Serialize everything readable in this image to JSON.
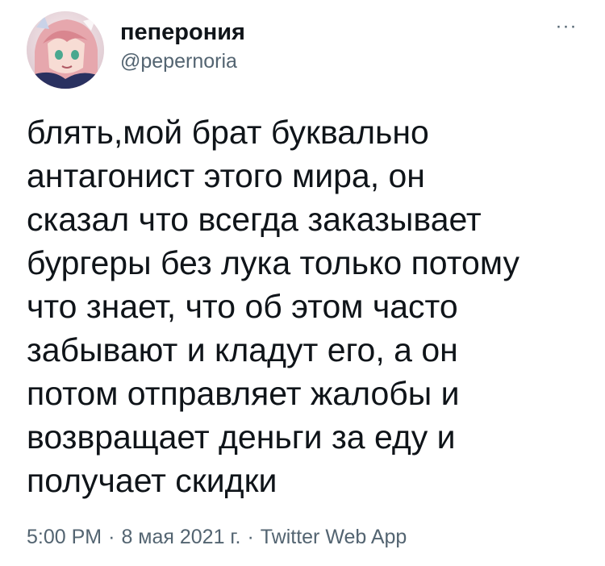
{
  "tweet": {
    "display_name": "пеперония",
    "handle": "@pepernoria",
    "more_icon": "more-dots-icon",
    "text_lines": [
      "блять,мой брат буквально",
      "антагонист этого мира, он",
      "сказал что всегда заказывает",
      "бургеры без лука только потому",
      "что знает, что об этом часто",
      "забывают и кладут его, а он",
      "потом отправляет жалобы и",
      "возвращает деньги за еду и",
      "получает скидки"
    ],
    "meta": {
      "time": "5:00 PM",
      "date": "8 мая 2021 г.",
      "source": "Twitter Web App",
      "separator": "·"
    }
  },
  "colors": {
    "text": "#0f1419",
    "secondary": "#536471",
    "background": "#ffffff"
  }
}
